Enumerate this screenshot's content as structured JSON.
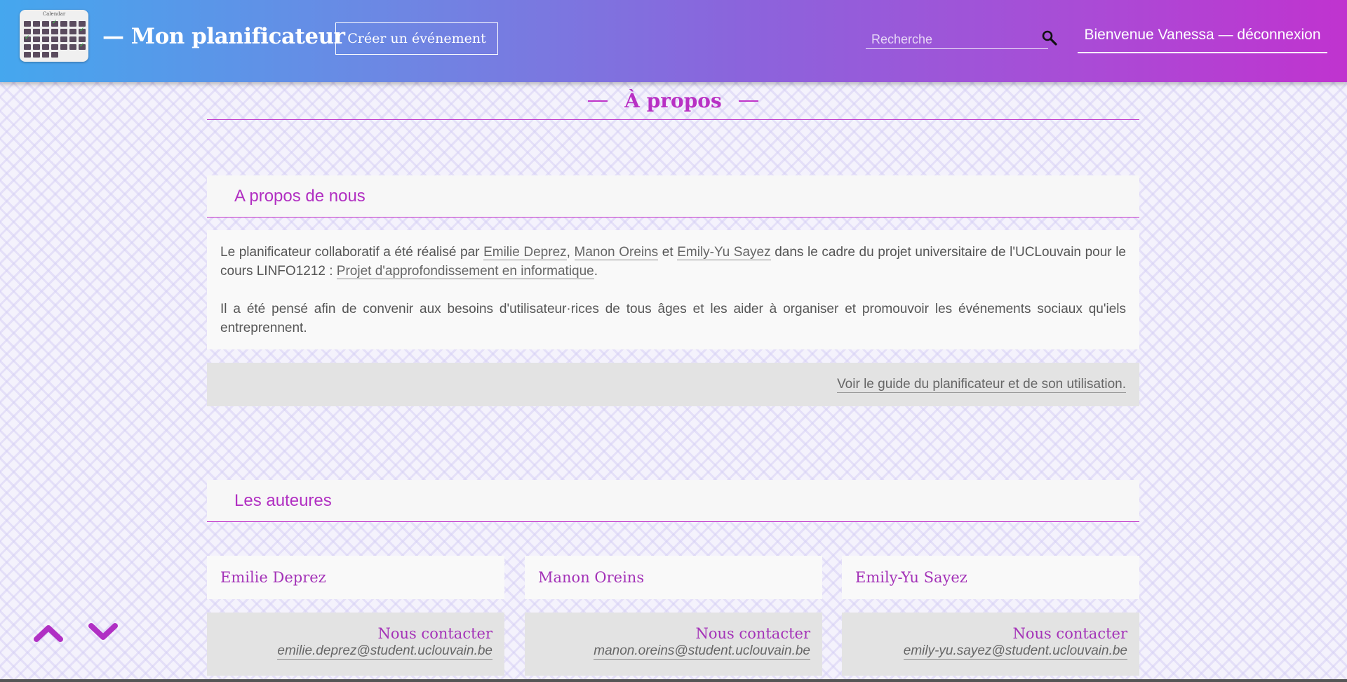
{
  "header": {
    "logo_text": "Calendar",
    "brand": "— Mon planificateur",
    "create_event_label": "Créer un événement",
    "search_placeholder": "Recherche",
    "welcome_label": "Bienvenue Vanessa — déconnexion",
    "search_icon": "search-icon"
  },
  "page": {
    "title": "À propos"
  },
  "about": {
    "heading": "A propos de nous",
    "p1_start": "Le planificateur collaboratif a été réalisé par ",
    "author1": "Emilie Deprez",
    "sep1": ", ",
    "author2": "Manon Oreins",
    "sep2": " et ",
    "author3": "Emily-Yu Sayez",
    "p1_mid": " dans le cadre du projet universitaire de l'UCLouvain pour le cours LINFO1212 : ",
    "course_link": "Projet d'approfondissement en informatique",
    "p1_end": ".",
    "p2": "Il a été pensé afin de convenir aux besoins d'utilisateur·rices de tous âges et les aider à organiser et promouvoir les événements sociaux qu'iels entreprennent.",
    "guide_link": "Voir le guide du planificateur et de son utilisation."
  },
  "authors": {
    "heading": "Les auteures",
    "contact_label": "Nous contacter",
    "list": [
      {
        "name": "Emilie Deprez",
        "email": "emilie.deprez@student.uclouvain.be"
      },
      {
        "name": "Manon Oreins",
        "email": "manon.oreins@student.uclouvain.be"
      },
      {
        "name": "Emily-Yu Sayez",
        "email": "emily-yu.sayez@student.uclouvain.be"
      }
    ]
  },
  "scroll": {
    "up_icon": "chevron-up-icon",
    "down_icon": "chevron-down-icon"
  },
  "colors": {
    "accent": "#b12fc2",
    "header_gradient_start": "#45a7ee",
    "header_gradient_end": "#c033cf"
  }
}
